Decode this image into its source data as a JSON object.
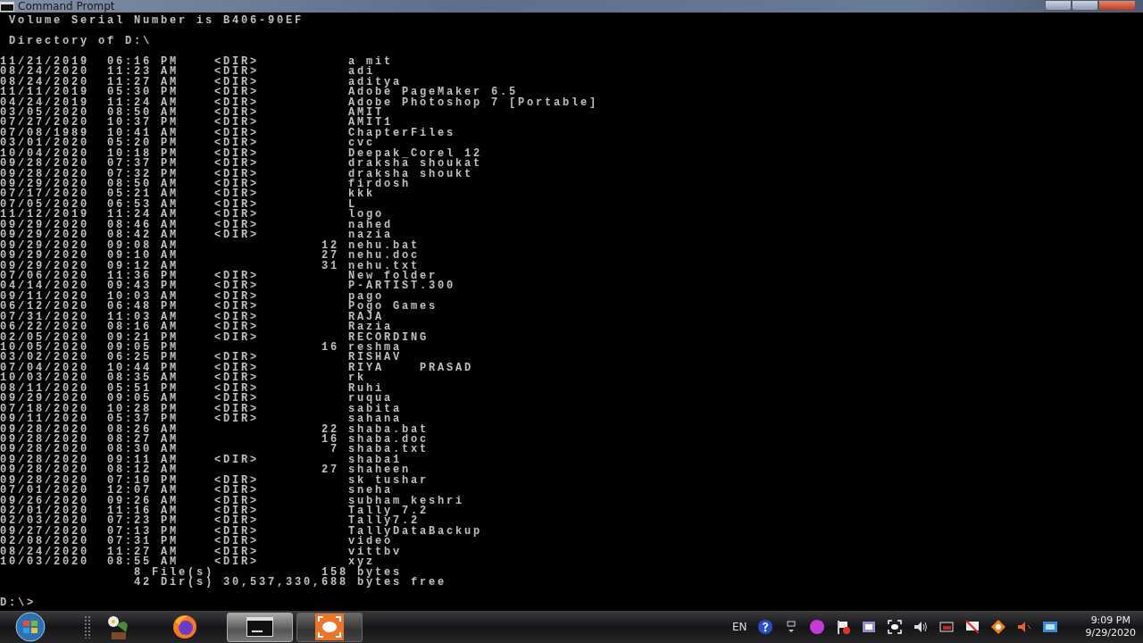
{
  "window": {
    "title": "Command Prompt"
  },
  "header_lines": [
    "Volume Serial Number is B406-90EF",
    "Directory of D:\\"
  ],
  "entries": [
    {
      "date": "11/21/2019",
      "time": "06:16 PM",
      "kind": "dir",
      "tag": "<DIR>",
      "name": "a mit"
    },
    {
      "date": "08/24/2020",
      "time": "11:23 AM",
      "kind": "dir",
      "tag": "<DIR>",
      "name": "adi"
    },
    {
      "date": "08/24/2020",
      "time": "11:27 AM",
      "kind": "dir",
      "tag": "<DIR>",
      "name": "aditya"
    },
    {
      "date": "11/11/2019",
      "time": "05:30 PM",
      "kind": "dir",
      "tag": "<DIR>",
      "name": "Adobe PageMaker 6.5"
    },
    {
      "date": "04/24/2019",
      "time": "11:24 AM",
      "kind": "dir",
      "tag": "<DIR>",
      "name": "Adobe Photoshop 7 [Portable]"
    },
    {
      "date": "03/05/2020",
      "time": "08:50 AM",
      "kind": "dir",
      "tag": "<DIR>",
      "name": "AMIT"
    },
    {
      "date": "07/27/2020",
      "time": "10:37 PM",
      "kind": "dir",
      "tag": "<DIR>",
      "name": "AMIT1"
    },
    {
      "date": "07/08/1989",
      "time": "10:41 AM",
      "kind": "dir",
      "tag": "<DIR>",
      "name": "ChapterFiles"
    },
    {
      "date": "03/01/2020",
      "time": "05:20 PM",
      "kind": "dir",
      "tag": "<DIR>",
      "name": "cvc"
    },
    {
      "date": "10/04/2020",
      "time": "10:18 PM",
      "kind": "dir",
      "tag": "<DIR>",
      "name": "Deepak_Corel 12"
    },
    {
      "date": "09/28/2020",
      "time": "07:37 PM",
      "kind": "dir",
      "tag": "<DIR>",
      "name": "draksha shoukat"
    },
    {
      "date": "09/28/2020",
      "time": "07:32 PM",
      "kind": "dir",
      "tag": "<DIR>",
      "name": "draksha shoukt"
    },
    {
      "date": "09/29/2020",
      "time": "08:50 AM",
      "kind": "dir",
      "tag": "<DIR>",
      "name": "firdosh"
    },
    {
      "date": "07/17/2020",
      "time": "05:21 AM",
      "kind": "dir",
      "tag": "<DIR>",
      "name": "kkk"
    },
    {
      "date": "07/05/2020",
      "time": "06:53 AM",
      "kind": "dir",
      "tag": "<DIR>",
      "name": "L"
    },
    {
      "date": "11/12/2019",
      "time": "11:24 AM",
      "kind": "dir",
      "tag": "<DIR>",
      "name": "logo"
    },
    {
      "date": "09/29/2020",
      "time": "08:46 AM",
      "kind": "dir",
      "tag": "<DIR>",
      "name": "nahed"
    },
    {
      "date": "09/29/2020",
      "time": "08:42 AM",
      "kind": "dir",
      "tag": "<DIR>",
      "name": "nazia"
    },
    {
      "date": "09/29/2020",
      "time": "09:08 AM",
      "kind": "file",
      "size": "12",
      "name": "nehu.bat"
    },
    {
      "date": "09/29/2020",
      "time": "09:10 AM",
      "kind": "file",
      "size": "27",
      "name": "nehu.doc"
    },
    {
      "date": "09/29/2020",
      "time": "09:12 AM",
      "kind": "file",
      "size": "31",
      "name": "nehu.txt"
    },
    {
      "date": "07/06/2020",
      "time": "11:36 PM",
      "kind": "dir",
      "tag": "<DIR>",
      "name": "New folder"
    },
    {
      "date": "04/14/2020",
      "time": "09:43 PM",
      "kind": "dir",
      "tag": "<DIR>",
      "name": "P-ARTIST.300"
    },
    {
      "date": "09/11/2020",
      "time": "10:03 AM",
      "kind": "dir",
      "tag": "<DIR>",
      "name": "pago"
    },
    {
      "date": "06/12/2020",
      "time": "06:48 PM",
      "kind": "dir",
      "tag": "<DIR>",
      "name": "Pogo Games"
    },
    {
      "date": "07/31/2020",
      "time": "11:03 AM",
      "kind": "dir",
      "tag": "<DIR>",
      "name": "RAJA"
    },
    {
      "date": "06/22/2020",
      "time": "08:16 AM",
      "kind": "dir",
      "tag": "<DIR>",
      "name": "Razia"
    },
    {
      "date": "02/05/2020",
      "time": "09:21 PM",
      "kind": "dir",
      "tag": "<DIR>",
      "name": "RECORDING"
    },
    {
      "date": "10/05/2020",
      "time": "09:05 PM",
      "kind": "file",
      "size": "16",
      "name": "reshma"
    },
    {
      "date": "03/02/2020",
      "time": "06:25 PM",
      "kind": "dir",
      "tag": "<DIR>",
      "name": "RISHAV"
    },
    {
      "date": "07/04/2020",
      "time": "10:44 PM",
      "kind": "dir",
      "tag": "<DIR>",
      "name": "RIYA    PRASAD"
    },
    {
      "date": "10/03/2020",
      "time": "08:35 AM",
      "kind": "dir",
      "tag": "<DIR>",
      "name": "rk"
    },
    {
      "date": "08/11/2020",
      "time": "05:51 PM",
      "kind": "dir",
      "tag": "<DIR>",
      "name": "Ruhi"
    },
    {
      "date": "09/29/2020",
      "time": "09:05 AM",
      "kind": "dir",
      "tag": "<DIR>",
      "name": "ruqua"
    },
    {
      "date": "07/18/2020",
      "time": "10:28 PM",
      "kind": "dir",
      "tag": "<DIR>",
      "name": "sabita"
    },
    {
      "date": "09/11/2020",
      "time": "05:37 PM",
      "kind": "dir",
      "tag": "<DIR>",
      "name": "sahana"
    },
    {
      "date": "09/28/2020",
      "time": "08:26 AM",
      "kind": "file",
      "size": "22",
      "name": "shaba.bat"
    },
    {
      "date": "09/28/2020",
      "time": "08:27 AM",
      "kind": "file",
      "size": "16",
      "name": "shaba.doc"
    },
    {
      "date": "09/28/2020",
      "time": "08:30 AM",
      "kind": "file",
      "size": "7",
      "name": "shaba.txt"
    },
    {
      "date": "09/28/2020",
      "time": "09:11 AM",
      "kind": "dir",
      "tag": "<DIR>",
      "name": "shaba1"
    },
    {
      "date": "09/28/2020",
      "time": "08:12 AM",
      "kind": "file",
      "size": "27",
      "name": "shaheen"
    },
    {
      "date": "09/28/2020",
      "time": "07:10 PM",
      "kind": "dir",
      "tag": "<DIR>",
      "name": "sk tushar"
    },
    {
      "date": "07/01/2020",
      "time": "12:07 AM",
      "kind": "dir",
      "tag": "<DIR>",
      "name": "sneha"
    },
    {
      "date": "09/26/2020",
      "time": "09:26 AM",
      "kind": "dir",
      "tag": "<DIR>",
      "name": "subham keshri"
    },
    {
      "date": "02/01/2020",
      "time": "11:16 AM",
      "kind": "dir",
      "tag": "<DIR>",
      "name": "Tally 7.2"
    },
    {
      "date": "02/03/2020",
      "time": "07:23 PM",
      "kind": "dir",
      "tag": "<DIR>",
      "name": "Tally7.2"
    },
    {
      "date": "09/27/2020",
      "time": "07:13 PM",
      "kind": "dir",
      "tag": "<DIR>",
      "name": "TallyDataBackup"
    },
    {
      "date": "02/08/2020",
      "time": "07:31 PM",
      "kind": "dir",
      "tag": "<DIR>",
      "name": "video"
    },
    {
      "date": "08/24/2020",
      "time": "11:27 AM",
      "kind": "dir",
      "tag": "<DIR>",
      "name": "vittbv"
    },
    {
      "date": "10/03/2020",
      "time": "08:55 AM",
      "kind": "dir",
      "tag": "<DIR>",
      "name": "xyz"
    }
  ],
  "summary": [
    {
      "count": "8 File(s)",
      "amount": "158",
      "unit": "bytes"
    },
    {
      "count": "42 Dir(s)",
      "amount": "30,537,330,688",
      "unit": "bytes free"
    }
  ],
  "prompt": "D:\\>",
  "taskbar": {
    "apps": [
      {
        "kind": "plant",
        "selected": false
      },
      {
        "kind": "browser",
        "selected": false
      },
      {
        "kind": "console",
        "selected": true
      },
      {
        "kind": "recorder",
        "selected": false
      }
    ],
    "language": "EN",
    "clock": {
      "time": "9:09 PM",
      "date": "9/29/2020"
    }
  }
}
